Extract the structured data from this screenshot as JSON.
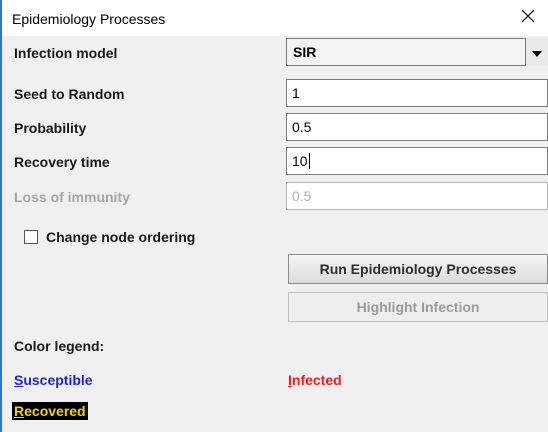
{
  "window": {
    "title": "Epidemiology Processes",
    "close_glyph": "×"
  },
  "form": {
    "infection_model": {
      "label": "Infection model",
      "value": "SIR"
    },
    "seed": {
      "label": "Seed to Random",
      "value": "1"
    },
    "probability": {
      "label": "Probability",
      "value": "0.5"
    },
    "recovery_time": {
      "label": "Recovery time",
      "value": "10"
    },
    "loss_of_immunity": {
      "label": "Loss of immunity",
      "value": "0.5",
      "enabled": false
    },
    "change_node_ordering": {
      "label": "Change node ordering",
      "checked": false
    }
  },
  "buttons": {
    "run": "Run Epidemiology Processes",
    "highlight": "Highlight Infection"
  },
  "legend": {
    "heading": "Color legend:",
    "susceptible": {
      "mnemonic": "S",
      "rest": "usceptible",
      "color": "#1f1fe0"
    },
    "infected": {
      "mnemonic": "I",
      "rest": "nfected",
      "color": "#ee1c1c"
    },
    "recovered": {
      "mnemonic": "R",
      "rest": "ecovered",
      "color": "#f2d600",
      "background": "#000000"
    }
  },
  "icons": {
    "combo_arrow": "chevron-down-icon",
    "close": "close-icon"
  }
}
